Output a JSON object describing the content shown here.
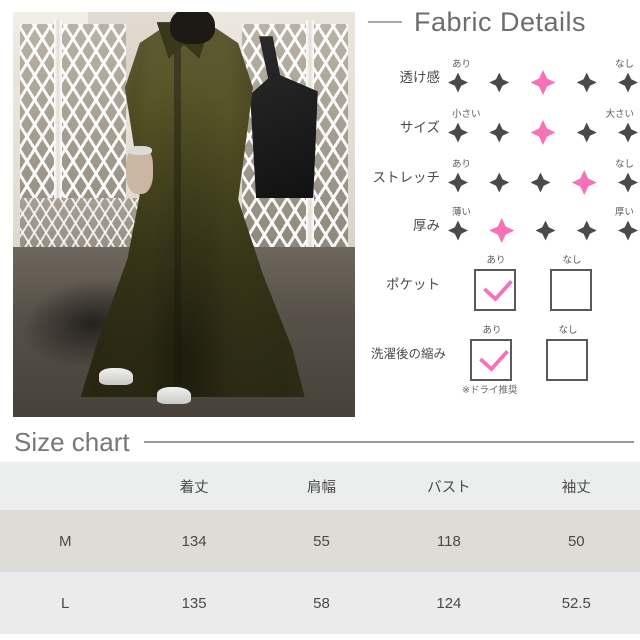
{
  "fabric": {
    "title": "Fabric Details",
    "attributes": [
      {
        "label": "透け感",
        "type": "scale",
        "left_cap": "あり",
        "right_cap": "なし",
        "steps": 5,
        "selected": 3
      },
      {
        "label": "サイズ",
        "type": "scale",
        "left_cap": "小さい",
        "right_cap": "大さい",
        "steps": 5,
        "selected": 3
      },
      {
        "label": "ストレッチ",
        "type": "scale",
        "left_cap": "あり",
        "right_cap": "なし",
        "steps": 5,
        "selected": 4
      },
      {
        "label": "厚み",
        "type": "scale",
        "left_cap": "薄い",
        "right_cap": "厚い",
        "steps": 5,
        "selected": 2
      },
      {
        "label": "ポケット",
        "type": "checkbox",
        "options": [
          {
            "caption": "あり",
            "checked": true
          },
          {
            "caption": "なし",
            "checked": false
          }
        ]
      },
      {
        "label": "洗濯後の縮み",
        "type": "checkbox",
        "options": [
          {
            "caption": "あり",
            "checked": true
          },
          {
            "caption": "なし",
            "checked": false
          }
        ]
      }
    ],
    "note": "※ドライ推奨"
  },
  "size_chart": {
    "title": "Size chart",
    "columns": [
      "",
      "着丈",
      "肩幅",
      "バスト",
      "袖丈"
    ],
    "rows": [
      {
        "size": "M",
        "values": [
          "134",
          "55",
          "118",
          "50"
        ]
      },
      {
        "size": "L",
        "values": [
          "135",
          "58",
          "124",
          "52.5"
        ]
      }
    ]
  },
  "photo": {
    "alt": "model-wearing-olive-long-shirt-dress"
  },
  "colors": {
    "accent_pink": "#f472b5",
    "diamond_dark": "#4a4a4a",
    "header_row": "#eceded",
    "row_m": "#dedcd6",
    "row_l": "#ebebeb",
    "heading_gray": "#6d6d6d"
  }
}
